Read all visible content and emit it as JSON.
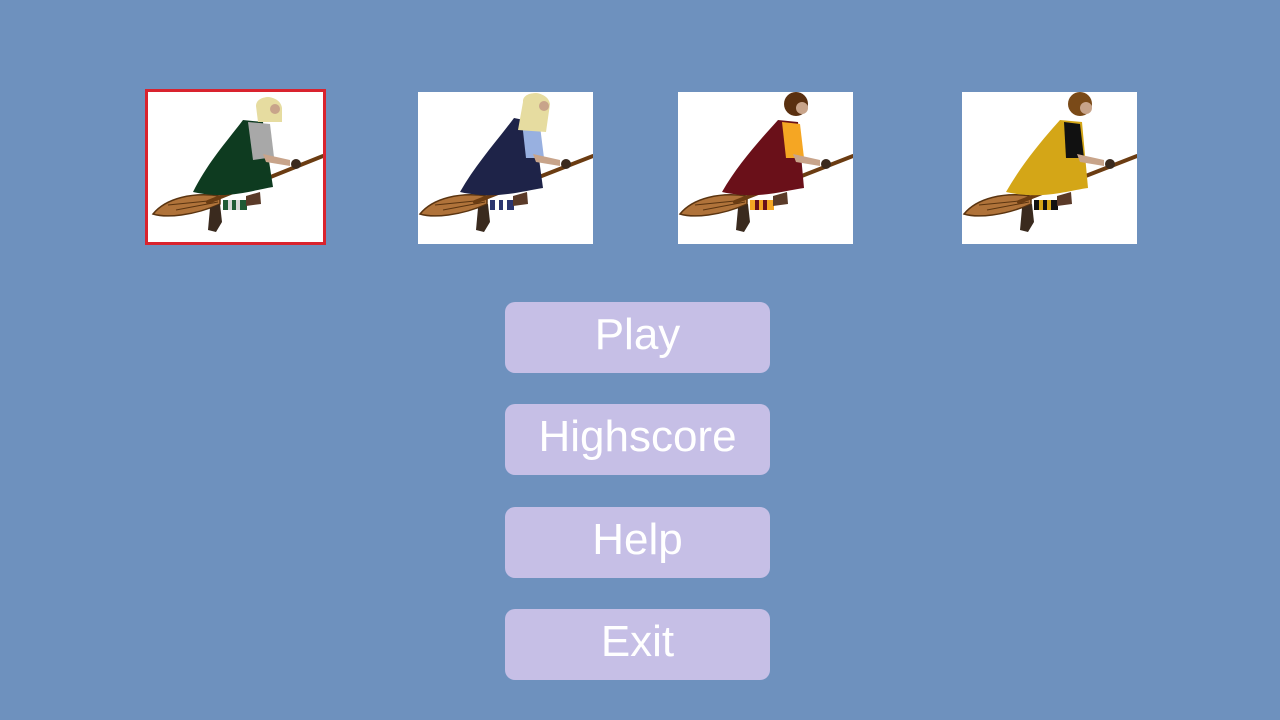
{
  "theme": {
    "background": "#6e91be",
    "button_bg": "#c6bfe6",
    "button_text": "#ffffff",
    "selection_border": "#d9232e"
  },
  "characters": [
    {
      "id": "green-seeker",
      "selected": true,
      "hair": "#e6dca0",
      "robe": "#0e3b20",
      "sleeve": "#a8a8a8",
      "sock_a": "#1f5a35",
      "sock_b": "#d8d8d8"
    },
    {
      "id": "blue-seeker",
      "selected": false,
      "hair": "#e6dca0",
      "robe": "#1e2348",
      "sleeve": "#98b0e0",
      "sock_a": "#2b3570",
      "sock_b": "#ffffff"
    },
    {
      "id": "red-seeker",
      "selected": false,
      "hair": "#5a3010",
      "robe": "#6a1019",
      "sleeve": "#f5a623",
      "sock_a": "#f5a623",
      "sock_b": "#6a1019"
    },
    {
      "id": "yellow-seeker",
      "selected": false,
      "hair": "#7a4a18",
      "robe": "#d4a617",
      "sleeve": "#111111",
      "sock_a": "#111111",
      "sock_b": "#d4a617"
    }
  ],
  "menu": {
    "play": "Play",
    "highscore": "Highscore",
    "help": "Help",
    "exit": "Exit"
  }
}
